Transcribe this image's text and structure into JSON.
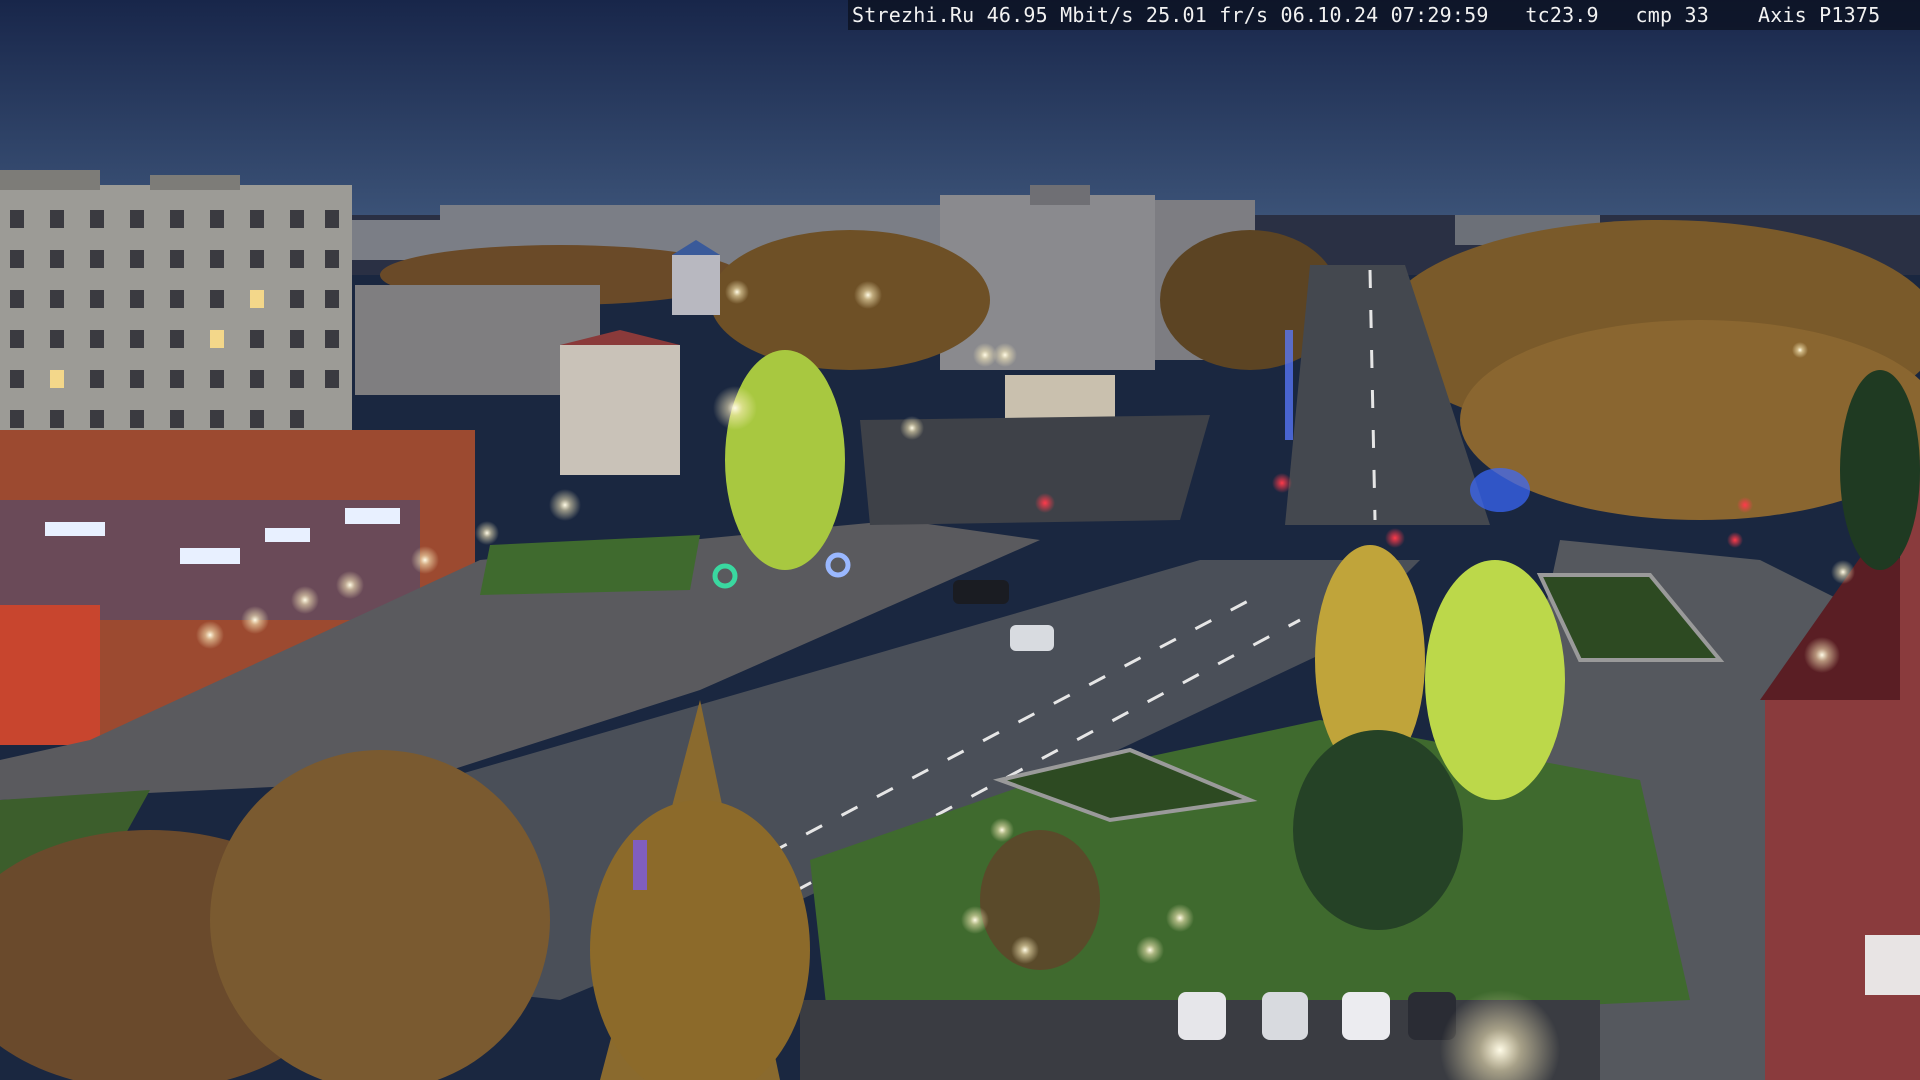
{
  "overlay": {
    "site": "Strezhi.Ru",
    "bitrate": "46.95 Mbit/s",
    "fps": "25.01 fr/s",
    "datetime": "06.10.24 07:29:59",
    "tc": "tc23.9",
    "cmp": "cmp 33",
    "camera": "Axis P1375"
  },
  "colors": {
    "sky_top": "#1b2a4a",
    "sky_bottom": "#3c5478",
    "road": "#4a4f5a",
    "grass": "#3f6a2e",
    "foliage_autumn": "#b8862e",
    "tree_lit": "#bcd84a",
    "lamp_light": "#fff6d8",
    "traffic_red": "#ff2a3a"
  }
}
